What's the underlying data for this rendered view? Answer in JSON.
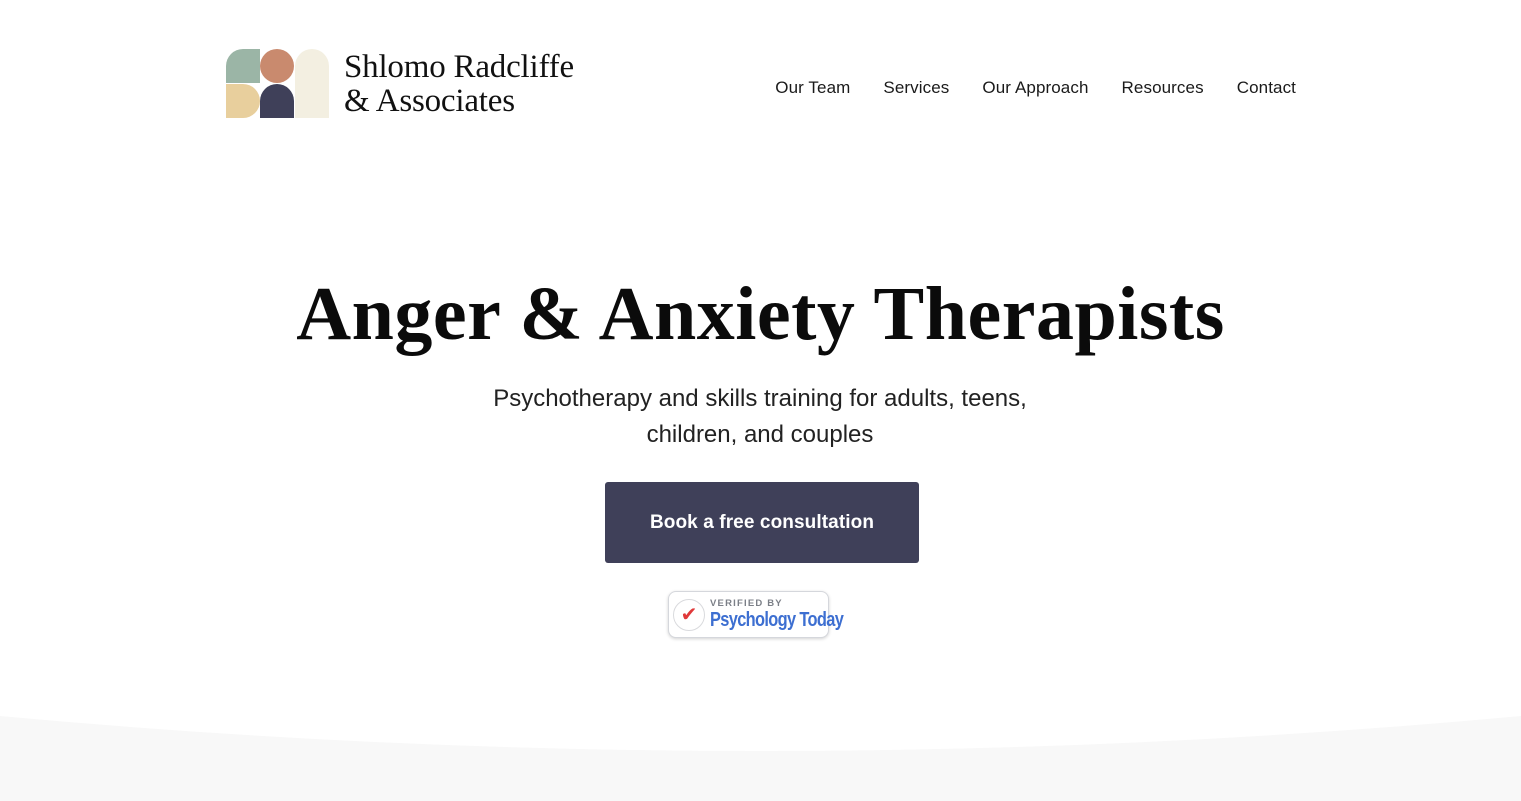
{
  "brand": {
    "name_line1": "Shlomo Radcliffe",
    "name_line2": "& Associates",
    "logo_icon": "logo-mark-shapes",
    "colors": {
      "sage": "#9bb5a6",
      "terracotta": "#c98a6e",
      "cream": "#f3efe1",
      "sand": "#e8cf9d",
      "navy": "#3f4059"
    }
  },
  "nav": {
    "items": [
      {
        "label": "Our Team"
      },
      {
        "label": "Services"
      },
      {
        "label": "Our Approach"
      },
      {
        "label": "Resources"
      },
      {
        "label": "Contact"
      }
    ]
  },
  "hero": {
    "title": "Anger & Anxiety Therapists",
    "subtitle": "Psychotherapy and skills training for adults, teens, children, and couples",
    "cta_label": "Book a free consultation",
    "cta_color": "#3f4059"
  },
  "badge": {
    "small_text": "VERIFIED BY",
    "brand_text": "Psychology Today",
    "icon": "checkmark-icon",
    "check_color": "#e0393a",
    "brand_color": "#3d6fd1"
  },
  "section_bg": "#f8f8f8"
}
